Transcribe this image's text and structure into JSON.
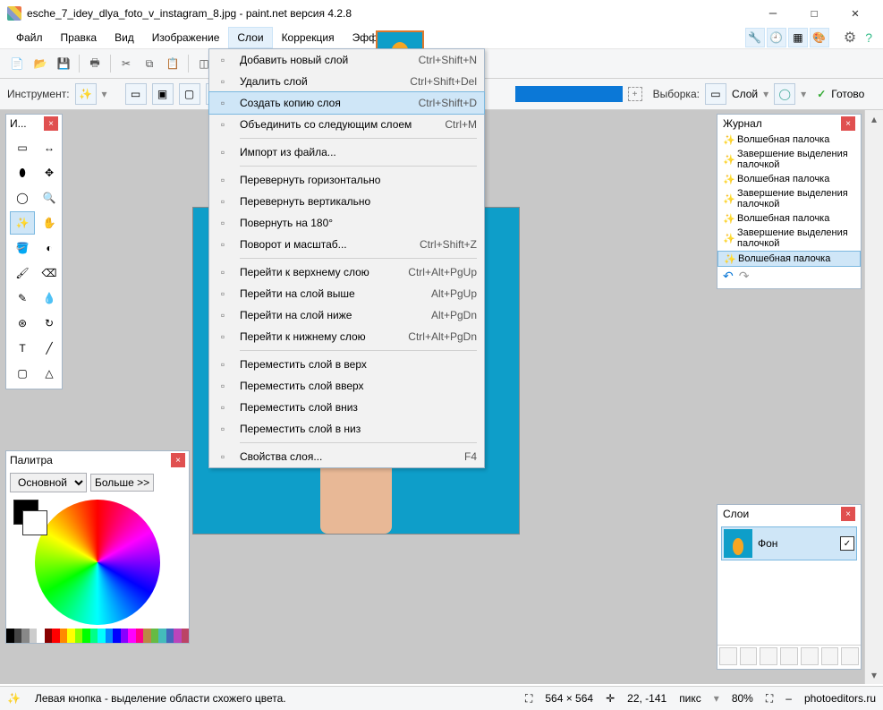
{
  "title": "esche_7_idey_dlya_foto_v_instagram_8.jpg - paint.net версия 4.2.8",
  "menu": {
    "file": "Файл",
    "edit": "Правка",
    "view": "Вид",
    "image": "Изображение",
    "layers": "Слои",
    "correction": "Коррекция",
    "effects": "Эффекты"
  },
  "optbar": {
    "tool": "Инструмент:",
    "sample": "Выборка:",
    "layer": "Слой",
    "ready": "Готово"
  },
  "dropdown": [
    {
      "icon": "add-layer-icon",
      "label": "Добавить новый слой",
      "shortcut": "Ctrl+Shift+N"
    },
    {
      "icon": "delete-layer-icon",
      "label": "Удалить слой",
      "shortcut": "Ctrl+Shift+Del"
    },
    {
      "icon": "duplicate-layer-icon",
      "label": "Создать копию слоя",
      "shortcut": "Ctrl+Shift+D",
      "hi": true
    },
    {
      "icon": "merge-down-icon",
      "label": "Объединить со следующим слоем",
      "shortcut": "Ctrl+M"
    },
    {
      "sep": true
    },
    {
      "icon": "import-icon",
      "label": "Импорт из файла...",
      "shortcut": ""
    },
    {
      "sep": true
    },
    {
      "icon": "flip-h-icon",
      "label": "Перевернуть горизонтально",
      "shortcut": ""
    },
    {
      "icon": "flip-v-icon",
      "label": "Перевернуть вертикально",
      "shortcut": ""
    },
    {
      "icon": "rotate-180-icon",
      "label": "Повернуть на 180°",
      "shortcut": ""
    },
    {
      "icon": "rotate-zoom-icon",
      "label": "Поворот и масштаб...",
      "shortcut": "Ctrl+Shift+Z"
    },
    {
      "sep": true
    },
    {
      "icon": "top-icon",
      "label": "Перейти к верхнему слою",
      "shortcut": "Ctrl+Alt+PgUp"
    },
    {
      "icon": "up-icon",
      "label": "Перейти на слой выше",
      "shortcut": "Alt+PgUp"
    },
    {
      "icon": "down-icon",
      "label": "Перейти на слой ниже",
      "shortcut": "Alt+PgDn"
    },
    {
      "icon": "bottom-icon",
      "label": "Перейти к нижнему слою",
      "shortcut": "Ctrl+Alt+PgDn"
    },
    {
      "sep": true
    },
    {
      "icon": "move-top-icon",
      "label": "Переместить слой в верх",
      "shortcut": ""
    },
    {
      "icon": "move-up-icon",
      "label": "Переместить слой вверх",
      "shortcut": ""
    },
    {
      "icon": "move-down-icon",
      "label": "Переместить слой вниз",
      "shortcut": ""
    },
    {
      "icon": "move-bottom-icon",
      "label": "Переместить слой в низ",
      "shortcut": ""
    },
    {
      "sep": true
    },
    {
      "icon": "props-icon",
      "label": "Свойства слоя...",
      "shortcut": "F4"
    }
  ],
  "toolbox": {
    "title": "И..."
  },
  "palette": {
    "title": "Палитра",
    "primary": "Основной",
    "more": "Больше >>",
    "strip": [
      "#000",
      "#444",
      "#888",
      "#ccc",
      "#fff",
      "#800",
      "#f00",
      "#f80",
      "#ff0",
      "#8f0",
      "#0f0",
      "#0f8",
      "#0ff",
      "#08f",
      "#00f",
      "#80f",
      "#f0f",
      "#f08",
      "#b84",
      "#6b4",
      "#4bb",
      "#46b",
      "#b4b",
      "#b46"
    ]
  },
  "history": {
    "title": "Журнал",
    "items": [
      "Волшебная палочка",
      "Завершение выделения палочкой",
      "Волшебная палочка",
      "Завершение выделения палочкой",
      "Волшебная палочка",
      "Завершение выделения палочкой",
      "Волшебная палочка"
    ]
  },
  "layers": {
    "title": "Слои",
    "bg": "Фон"
  },
  "status": {
    "hint": "Левая кнопка - выделение области схожего цвета.",
    "dims": "564 × 564",
    "coords": "22, -141",
    "unit": "пикс",
    "zoom": "80%",
    "attr": "photoeditors.ru"
  }
}
